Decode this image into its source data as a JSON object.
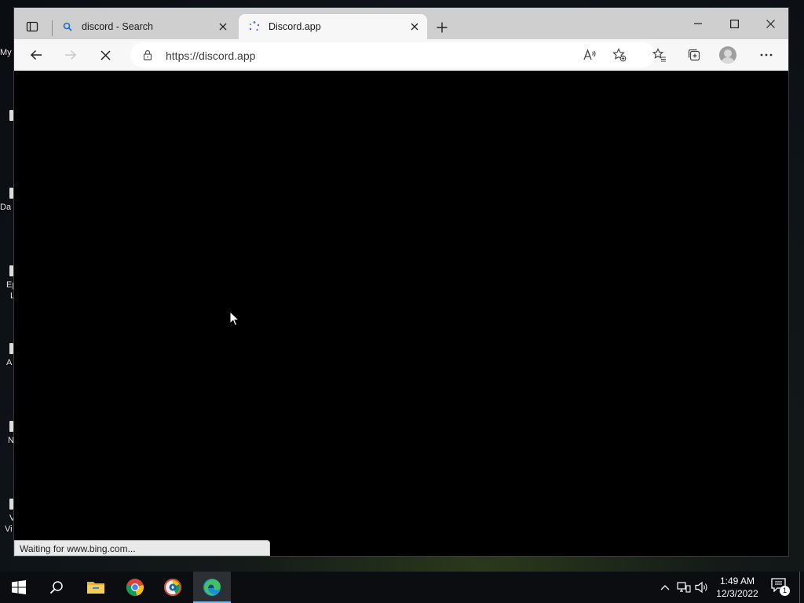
{
  "desktop": {
    "fragments": [
      "My",
      "Da",
      "Ep",
      "L",
      "A",
      "N",
      "V",
      "Vi"
    ]
  },
  "browser": {
    "tabs": [
      {
        "title": "discord - Search",
        "favicon": "search-icon",
        "active": false
      },
      {
        "title": "Discord.app",
        "favicon": "loading-spinner-icon",
        "active": true
      }
    ],
    "address_bar": {
      "url": "https://discord.app"
    },
    "status_text": "Waiting for www.bing.com..."
  },
  "taskbar": {
    "apps": [
      "start-icon",
      "search-icon",
      "file-explorer-icon",
      "chrome-icon",
      "brave-icon",
      "edge-icon"
    ],
    "active_app": "edge-icon",
    "clock": {
      "time": "1:49 AM",
      "date": "12/3/2022"
    },
    "notification_count": "1"
  },
  "colors": {
    "accent": "#76b9ed",
    "tabstrip": "#cfcfcf",
    "toolbar": "#f7f7f7",
    "content": "#000000"
  }
}
